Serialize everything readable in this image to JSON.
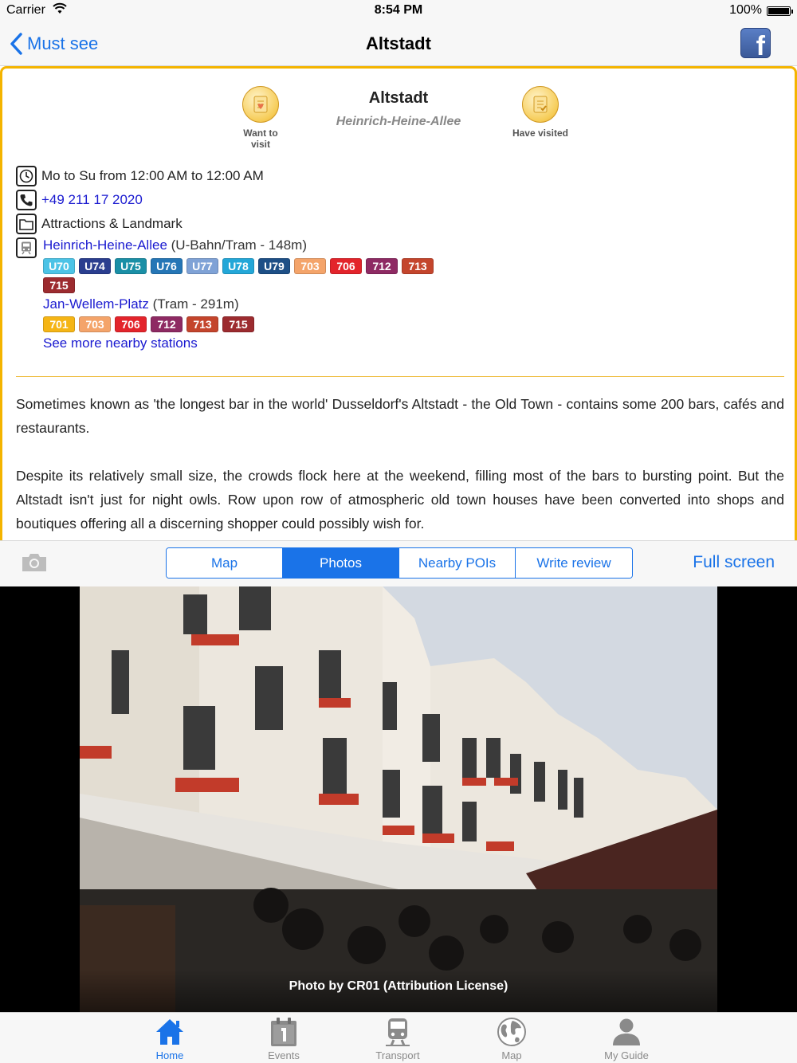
{
  "status_bar": {
    "carrier": "Carrier",
    "time": "8:54 PM",
    "battery": "100%"
  },
  "nav": {
    "back_label": "Must see",
    "title": "Altstadt",
    "share_icon": "facebook-icon",
    "share_letter": "f"
  },
  "poi": {
    "title": "Altstadt",
    "subtitle": "Heinrich-Heine-Allee",
    "want_label_1": "Want to",
    "want_label_2": "visit",
    "visited_label": "Have visited",
    "hours": "Mo to Su from 12:00 AM to 12:00 AM",
    "phone": "+49 211 17 2020",
    "category": "Attractions & Landmark",
    "stations": [
      {
        "name": "Heinrich-Heine-Allee",
        "detail": " (U-Bahn/Tram - 148m)",
        "lines": [
          {
            "label": "U70",
            "color": "#4cc3e6"
          },
          {
            "label": "U74",
            "color": "#2a3e8f"
          },
          {
            "label": "U75",
            "color": "#1a8fa6"
          },
          {
            "label": "U76",
            "color": "#2576b6"
          },
          {
            "label": "U77",
            "color": "#7fa2d6"
          },
          {
            "label": "U78",
            "color": "#23a7d8"
          },
          {
            "label": "U79",
            "color": "#1d4f86"
          },
          {
            "label": "703",
            "color": "#f4a46a"
          },
          {
            "label": "706",
            "color": "#e3242b"
          },
          {
            "label": "712",
            "color": "#8e2a63"
          },
          {
            "label": "713",
            "color": "#c4452c"
          },
          {
            "label": "715",
            "color": "#9c2b2f"
          }
        ]
      },
      {
        "name": "Jan-Wellem-Platz",
        "detail": " (Tram - 291m)",
        "lines": [
          {
            "label": "701",
            "color": "#f5b515"
          },
          {
            "label": "703",
            "color": "#f4a46a"
          },
          {
            "label": "706",
            "color": "#e3242b"
          },
          {
            "label": "712",
            "color": "#8e2a63"
          },
          {
            "label": "713",
            "color": "#c4452c"
          },
          {
            "label": "715",
            "color": "#9c2b2f"
          }
        ]
      }
    ],
    "more_stations": "See more nearby stations",
    "description": [
      "Sometimes known as 'the longest bar in the world' Dusseldorf's Altstadt - the Old Town - contains some 200 bars, cafés and restaurants.",
      "Despite its relatively small size, the crowds flock here at the weekend, filling most of the bars to bursting point. But the Altstadt isn't just for night owls. Row upon row of atmospheric old town houses have been converted into shops and boutiques offering all a discerning shopper could possibly wish for."
    ]
  },
  "toolbar": {
    "segments": [
      "Map",
      "Photos",
      "Nearby POIs",
      "Write review"
    ],
    "active_segment": "Photos",
    "fullscreen": "Full screen"
  },
  "photo": {
    "caption": "Photo by CR01 (Attribution License)"
  },
  "tabbar": {
    "items": [
      {
        "label": "Home",
        "icon": "home-icon"
      },
      {
        "label": "Events",
        "icon": "calendar-icon"
      },
      {
        "label": "Transport",
        "icon": "train-icon"
      },
      {
        "label": "Map",
        "icon": "globe-icon"
      },
      {
        "label": "My Guide",
        "icon": "person-icon"
      }
    ],
    "active": "Home"
  },
  "colors": {
    "accent": "#1a73e8",
    "panel_border": "#f4b400",
    "link": "#1a1ad0"
  }
}
